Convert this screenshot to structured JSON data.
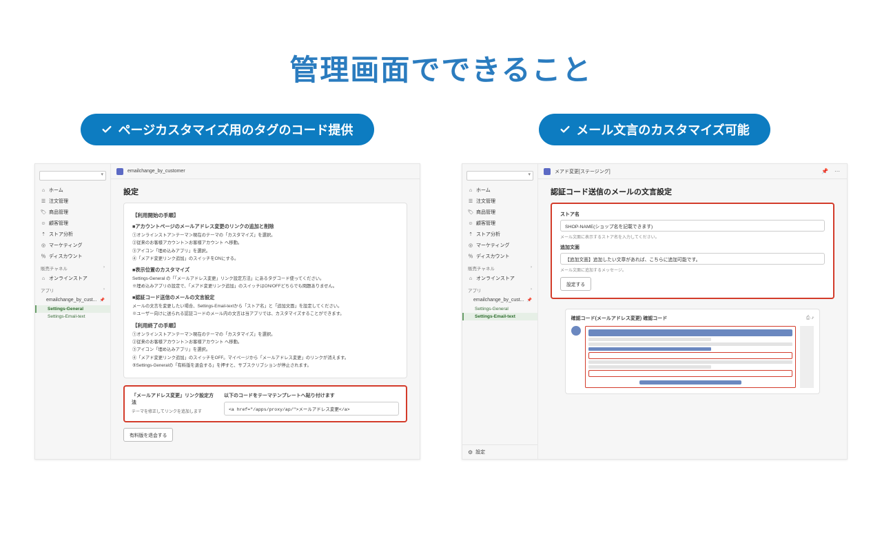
{
  "page_title": "管理画面でできること",
  "left_pill": "ページカスタマイズ用のタグのコード提供",
  "right_pill": "メール文言のカスタマイズ可能",
  "sidebar": {
    "items": [
      {
        "icon": "home",
        "label": "ホーム"
      },
      {
        "icon": "orders",
        "label": "注文管理"
      },
      {
        "icon": "products",
        "label": "商品管理"
      },
      {
        "icon": "customers",
        "label": "顧客管理"
      },
      {
        "icon": "analytics",
        "label": "ストア分析"
      },
      {
        "icon": "marketing",
        "label": "マーケティング"
      },
      {
        "icon": "discounts",
        "label": "ディスカウント"
      }
    ],
    "sales_channel_label": "販売チャネル",
    "online_store_label": "オンラインストア",
    "apps_label": "アプリ",
    "app_name": "emailchange_by_cust...",
    "sub_general": "Settings-General",
    "sub_emailtext": "Settings-Email-text",
    "settings_label": "設定"
  },
  "left_shot": {
    "topbar_title": "emailchange_by_customer",
    "heading": "設定",
    "sec1_title": "【利用開始の手順】",
    "sub1": "■アカウントページのメールアドレス変更のリンクの追加と削除",
    "p1a": "①オンラインストア＞テーマ＞現在のテーマの「カスタマイズ」を選択。",
    "p1b": "②従来のお客様アカウント＞お客様アカウント へ移動。",
    "p1c": "③アイコン「埋め込みアプリ」を選択。",
    "p1d": "④「メアド変更リンク追加」のスイッチをONにする。",
    "sub2": "■表示位置のカスタマイズ",
    "p2a": "Settings-General の「「メールアドレス変更」リンク設定方法」にあるタグコード使ってください。",
    "p2b": "※埋め込みアプリの設定で、「メアド変更リンク追加」のスイッチはON/OFFどちらでも問題ありません。",
    "sub3": "■認証コード送信のメールの文言設定",
    "p3a": "メールの文言を変更したい場合、Settings-Email-textから「ストア名」と「追加文面」を設定してください。",
    "p3b": "※ユーザー向けに送られる認証コードのメール内の文言は当アプリでは、カスタマイズすることができます。",
    "sec2_title": "【利用終了の手順】",
    "p4a": "①オンラインストア＞テーマ＞現在のテーマの「カスタマイズ」を選択。",
    "p4b": "②従来のお客様アカウント＞お客様アカウント へ移動。",
    "p4c": "③アイコン「埋め込みアプリ」を選択。",
    "p4d": "④「メアド変更リンク追加」のスイッチをOFF。マイページから「メールアドレス変更」のリンクが消えます。",
    "p4e": "⑤Settings-Generalの「有料版を退会する」を押すと、サブスクリプションが停止されます。",
    "hl_left_title": "「メールアドレス変更」リンク設定方法",
    "hl_left_sub": "テーマを修正してリンクを追加します",
    "hl_right_title": "以下のコードをテーマテンプレートへ貼り付けます",
    "hl_code": "<a href=\"/apps/proxy/ap/\">メールアドレス変更</a>",
    "cancel_btn": "有料版を退会する"
  },
  "right_shot": {
    "topbar_title": "メアド変更[ステージング]",
    "heading": "認証コード送信のメールの文言設定",
    "label_store": "ストア名",
    "input_store_value": "SHOP-NAME(ショップ名を記載できます)",
    "hint_store": "メール文面に表示するストア名を入力してください。",
    "label_add": "追加文面",
    "input_add_value": "【追加文面】追加したい文章があれば、こちらに追加可能です。",
    "hint_add": "メール文面に追加するメッセージ。",
    "save_btn": "設定する",
    "preview_title": "確認コード(メールアドレス変更) 確認コード"
  }
}
